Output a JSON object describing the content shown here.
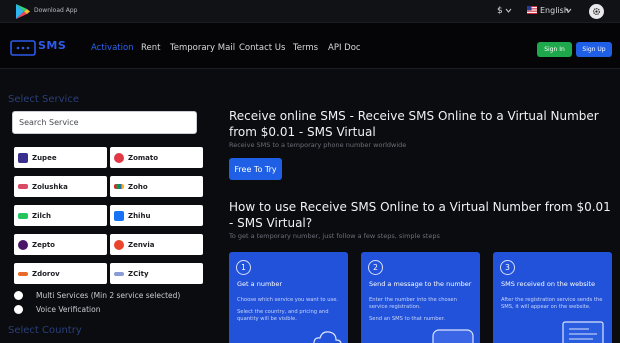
{
  "topbar": {
    "download_label": "Download App",
    "currency_symbol": "$",
    "language": "English"
  },
  "nav": {
    "links": [
      "Activation",
      "Rent",
      "Temporary Mail",
      "Contact Us",
      "Terms",
      "API Doc"
    ],
    "signin_label": "Sign In",
    "signup_label": "Sign Up"
  },
  "left": {
    "select_service_heading": "Select Service",
    "search_placeholder": "Search Service",
    "services": [
      "Zupee",
      "Zomato",
      "Zolushka",
      "Zoho",
      "Zilch",
      "Zhihu",
      "Zepto",
      "Zenvia",
      "Zdorov",
      "ZCity"
    ],
    "multi_services_label": "Multi Services (Min 2 service selected)",
    "voice_verification_label": "Voice Verification",
    "select_country_heading": "Select Country"
  },
  "main": {
    "title": "Receive online SMS - Receive SMS Online to a Virtual Number from $0.01 - SMS Virtual",
    "subtitle": "Receive SMS to a temporary phone number worldwide",
    "try_label": "Free To Try",
    "how_title": "How to use Receive SMS Online to a Virtual Number from $0.01 - SMS Virtual?",
    "how_subtitle": "To get a temporary number, just follow a few steps, simple steps",
    "steps": [
      {
        "num": "1",
        "title": "Get a number",
        "line1": "Choose which service you want to use.",
        "line2": "Select the country, and pricing and quantity will be visible."
      },
      {
        "num": "2",
        "title": "Send a message to the number",
        "line1": "Enter the number into the chosen service registration.",
        "line2": "Send an SMS to that number."
      },
      {
        "num": "3",
        "title": "SMS received on the website",
        "line1": "After the registration service sends the SMS, it will appear on the website.",
        "line2": ""
      }
    ]
  },
  "colors": {
    "accent": "#1f5fe6",
    "signin": "#1ea84b",
    "step_card": "#2152d9"
  }
}
